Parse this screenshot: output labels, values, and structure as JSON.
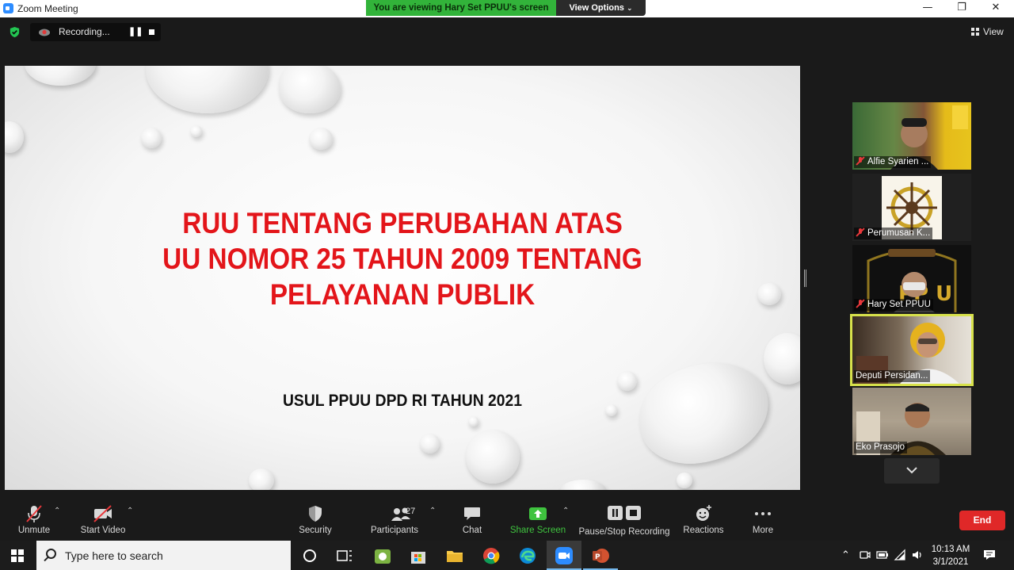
{
  "window": {
    "title": "Zoom Meeting",
    "viewing_banner": "You are viewing Hary Set PPUU's screen",
    "view_options": "View Options",
    "minimize": "—",
    "restore": "❐",
    "close": "✕"
  },
  "top_bar": {
    "recording_label": "Recording...",
    "pause_glyph": "❚❚",
    "view_label": "View"
  },
  "slide": {
    "title_lines": [
      "RUU TENTANG PERUBAHAN ATAS",
      "UU NOMOR 25 TAHUN 2009 TENTANG",
      "PELAYANAN PUBLIK"
    ],
    "subtitle": "USUL PPUU DPD RI TAHUN 2021",
    "title_color": "#e3151a"
  },
  "participants": [
    {
      "name": "Alfie Syarien ...",
      "muted": true,
      "active": false
    },
    {
      "name": "Perumusan K...",
      "muted": true,
      "active": false
    },
    {
      "name": "Hary Set PPUU",
      "muted": true,
      "active": false
    },
    {
      "name": "Deputi Persidan...",
      "muted": false,
      "active": true
    },
    {
      "name": "Eko Prasojo",
      "muted": false,
      "active": false
    }
  ],
  "toolbar": {
    "unmute": "Unmute",
    "start_video": "Start Video",
    "security": "Security",
    "participants": "Participants",
    "participants_count": "27",
    "chat": "Chat",
    "share_screen": "Share Screen",
    "pause_stop_recording": "Pause/Stop Recording",
    "reactions": "Reactions",
    "more": "More",
    "end": "End",
    "share_color": "#3fc33f",
    "end_color": "#e02828"
  },
  "taskbar": {
    "search_placeholder": "Type here to search",
    "time": "10:13 AM",
    "date": "3/1/2021"
  }
}
